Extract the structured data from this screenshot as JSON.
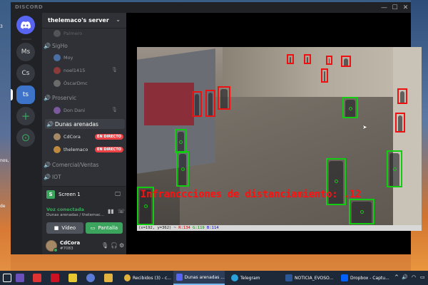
{
  "desktop": {
    "left_fragments": [
      "3",
      "nos,",
      "de"
    ]
  },
  "window": {
    "brand": "DISCORD",
    "controls": [
      "—",
      "☐",
      "✕"
    ]
  },
  "servers": [
    {
      "label": "",
      "icon": "discord-logo-icon"
    },
    {
      "label": "Ms"
    },
    {
      "label": "Cs"
    },
    {
      "label": "ts",
      "active": true
    },
    {
      "label": "+",
      "icon": "add-server-icon"
    },
    {
      "label": "⊙",
      "icon": "explore-icon"
    }
  ],
  "server": {
    "name": "thelemaco's server"
  },
  "channels": {
    "truncated_user": "Palmero",
    "sigho": {
      "name": "SigHo",
      "users": [
        "Moy",
        "noel1415",
        "ÓscarDmc"
      ]
    },
    "proservic": {
      "name": "Proservic",
      "users": [
        "Don Dani"
      ]
    },
    "dunas": {
      "name": "Dunas arenadas",
      "users": [
        {
          "name": "CdCora",
          "badge": "EN DIRECTO"
        },
        {
          "name": "thelemaco",
          "badge": "EN DIRECTO"
        }
      ]
    },
    "comercial": {
      "name": "Comercial/Ventas"
    },
    "iot": {
      "name": "IOT"
    }
  },
  "screenshare": {
    "label": "Screen 1"
  },
  "voice": {
    "status": "Voz conectada",
    "channel": "Dunas arenadas / thelemac...",
    "video_label": "Vídeo",
    "screen_label": "Pantalla",
    "accent": "#3ba55d"
  },
  "user": {
    "name": "CdCora",
    "tag": "#7083"
  },
  "stream": {
    "overlay_text": "Infranccciones de distanciamiento: .12",
    "coords_prefix": "(x=192, y=362) ~ ",
    "r": "R:134",
    "g": "G:119",
    "b": "B:114"
  },
  "taskbar": {
    "apps": [
      {
        "label": "Recibidos (3) - c..."
      },
      {
        "label": "Dunas arenadas ...",
        "active": true
      },
      {
        "label": "Telegram"
      },
      {
        "label": "NOTICIA_EVOSO..."
      },
      {
        "label": "Dropbox - Captu..."
      }
    ],
    "colors": {
      "chrome": "#e2b33c",
      "discord": "#5865f2",
      "telegram": "#2aa1da",
      "word": "#2b5797",
      "dropbox": "#0061fe"
    }
  }
}
